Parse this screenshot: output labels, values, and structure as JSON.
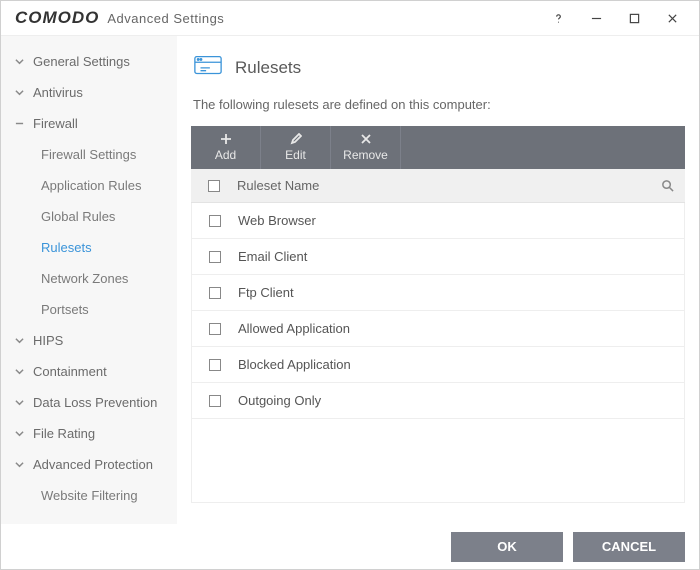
{
  "titlebar": {
    "brand": "COMODO",
    "subtitle": "Advanced Settings"
  },
  "sidebar": {
    "items": [
      {
        "label": "General Settings"
      },
      {
        "label": "Antivirus"
      },
      {
        "label": "Firewall"
      },
      {
        "label": "HIPS"
      },
      {
        "label": "Containment"
      },
      {
        "label": "Data Loss Prevention"
      },
      {
        "label": "File Rating"
      },
      {
        "label": "Advanced Protection"
      }
    ],
    "firewall_subs": [
      {
        "label": "Firewall Settings"
      },
      {
        "label": "Application Rules"
      },
      {
        "label": "Global Rules"
      },
      {
        "label": "Rulesets"
      },
      {
        "label": "Network Zones"
      },
      {
        "label": "Portsets"
      }
    ],
    "ap_subs": [
      {
        "label": "Website Filtering"
      }
    ]
  },
  "panel": {
    "title": "Rulesets",
    "desc": "The following rulesets are defined on this computer:",
    "toolbar": {
      "add": "Add",
      "edit": "Edit",
      "remove": "Remove"
    },
    "col": "Ruleset Name",
    "rows": [
      {
        "name": "Web Browser"
      },
      {
        "name": "Email Client"
      },
      {
        "name": "Ftp Client"
      },
      {
        "name": "Allowed Application"
      },
      {
        "name": "Blocked Application"
      },
      {
        "name": "Outgoing Only"
      }
    ]
  },
  "footer": {
    "ok": "OK",
    "cancel": "CANCEL"
  }
}
